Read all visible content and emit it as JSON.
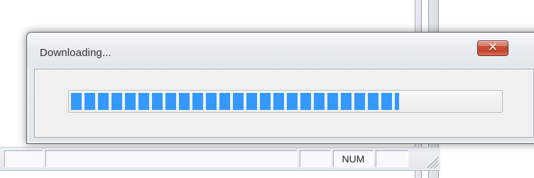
{
  "dialog": {
    "title": "Downloading...",
    "close_icon": "close-icon",
    "progress": {
      "fraction": 0.765,
      "color": "#3399ff"
    }
  },
  "status_bar": {
    "num_label": "NUM"
  },
  "colors": {
    "close_button": "#c94e37",
    "progress_blue": "#3399ff"
  }
}
